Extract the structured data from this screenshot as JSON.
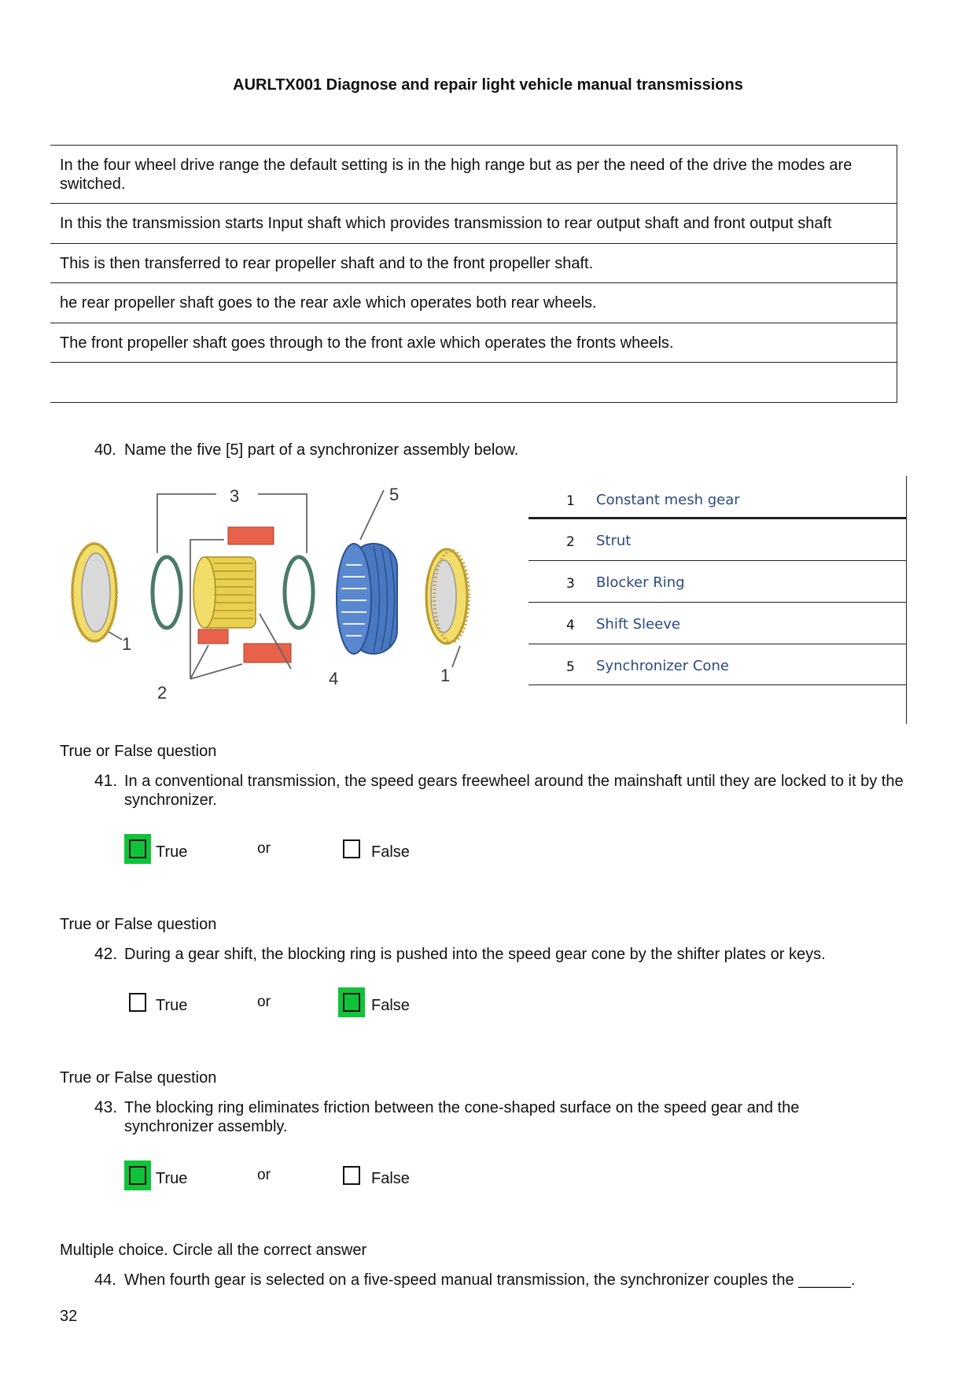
{
  "header": {
    "title": "AURLTX001 Diagnose and repair light vehicle manual transmissions"
  },
  "intro_table": {
    "rows": [
      "In the four wheel drive range the default setting is in the high range but as per the need of the drive the modes are switched.",
      "In this the transmission starts Input shaft which provides transmission to rear output shaft and front output shaft",
      "This is then transferred to rear propeller shaft and to the front propeller shaft.",
      "he rear propeller shaft goes to the rear axle which operates both rear wheels.",
      "The front propeller shaft goes through to the front axle which operates the fronts wheels.",
      ""
    ]
  },
  "q40": {
    "number": "40.",
    "text": "Name the five [5] part of a synchronizer assembly below.",
    "diagram_labels": [
      "1",
      "2",
      "3",
      "4",
      "5",
      "1"
    ],
    "parts": [
      {
        "num": "1",
        "name": "Constant mesh gear"
      },
      {
        "num": "2",
        "name": "Strut"
      },
      {
        "num": "3",
        "name": "Blocker Ring"
      },
      {
        "num": "4",
        "name": "Shift Sleeve"
      },
      {
        "num": "5",
        "name": "Synchronizer Cone"
      }
    ]
  },
  "questions": [
    {
      "section": "True or False question",
      "number": "41.",
      "text": "In a conventional transmission, the speed gears freewheel around the mainshaft until they are locked to it by the synchronizer.",
      "true_label": "True",
      "or_label": "or",
      "false_label": "False",
      "answer": "True"
    },
    {
      "section": "True or False question",
      "number": "42.",
      "text": "During a gear shift, the blocking ring is pushed into the speed gear cone by the shifter plates or keys.",
      "true_label": "True",
      "or_label": "or",
      "false_label": "False",
      "answer": "False"
    },
    {
      "section": "True or False question",
      "number": "43.",
      "text": "The blocking ring eliminates friction between the cone-shaped surface on the speed gear and the synchronizer assembly.",
      "true_label": "True",
      "or_label": "or",
      "false_label": "False",
      "answer": "True"
    }
  ],
  "q44": {
    "section": "Multiple choice. Circle all the correct answer",
    "number": "44.",
    "text": "When fourth gear is selected on a five-speed manual transmission, the synchronizer couples the ______."
  },
  "footer": {
    "page_number": "32"
  },
  "colors": {
    "checked_highlight": "#11c33a",
    "part_name": "#2a4a7f"
  }
}
